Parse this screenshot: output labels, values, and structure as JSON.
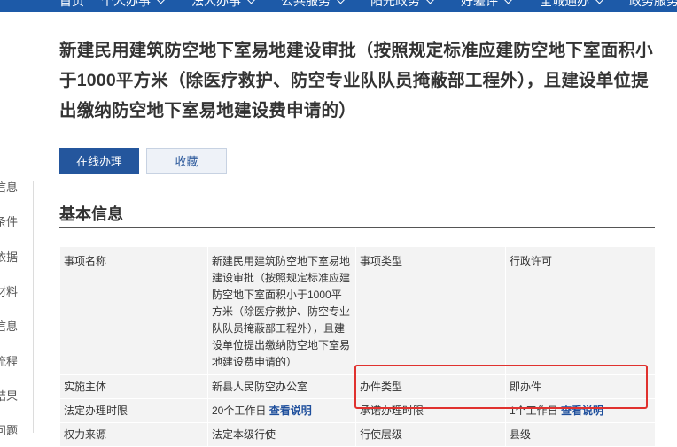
{
  "nav": {
    "items": [
      "首页",
      "个人办事",
      "法人办事",
      "公共服务",
      "阳光政务",
      "好差评",
      "全城通办",
      "政务服务"
    ]
  },
  "sidebar": {
    "items": [
      "信息",
      "条件",
      "依据",
      "材料",
      "信息",
      "流程",
      "结果",
      "问题"
    ]
  },
  "page": {
    "title": "新建民用建筑防空地下室易地建设审批（按照规定标准应建防空地下室面积小于1000平方米（除医疗救护、防空专业队队员掩蔽部工程外），且建设单位提出缴纳防空地下室易地建设费申请的）"
  },
  "actions": {
    "online_label": "在线办理",
    "favorite_label": "收藏"
  },
  "section": {
    "title": "基本信息"
  },
  "table": {
    "rows": [
      {
        "label1": "事项名称",
        "value1": "新建民用建筑防空地下室易地建设审批（按照规定标准应建防空地下室面积小于1000平方米（除医疗救护、防空专业队队员掩蔽部工程外），且建设单位提出缴纳防空地下室易地建设费申请的）",
        "label2": "事项类型",
        "value2": "行政许可"
      },
      {
        "label1": "实施主体",
        "value1": "新县人民防空办公室",
        "label2": "办件类型",
        "value2": "即办件"
      },
      {
        "label1": "法定办理时限",
        "value1": "20个工作日",
        "link1": "查看说明",
        "label2": "承诺办理时限",
        "value2": "1个工作日",
        "link2": "查看说明"
      },
      {
        "label1": "权力来源",
        "value1": "法定本级行使",
        "label2": "行使层级",
        "value2": "县级"
      }
    ]
  },
  "colors": {
    "nav_bg": "#1d5aa8",
    "primary_button": "#24569d",
    "highlight_border": "#e0312e",
    "link": "#1f4f9c"
  }
}
